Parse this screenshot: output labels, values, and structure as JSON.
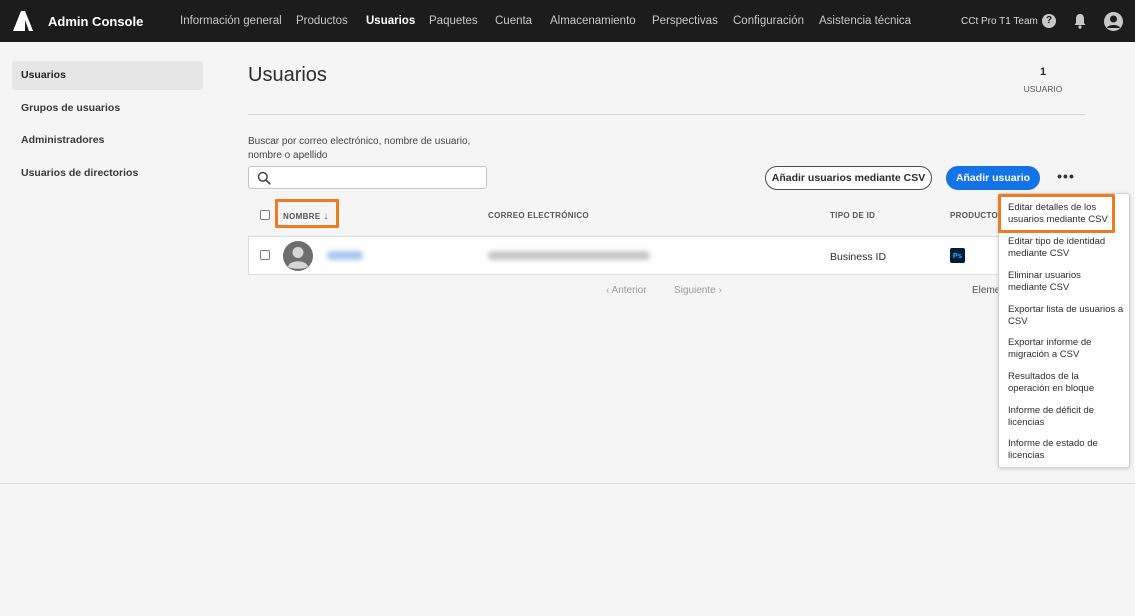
{
  "header": {
    "app_title": "Admin Console",
    "nav": [
      {
        "label": "Información general"
      },
      {
        "label": "Productos"
      },
      {
        "label": "Usuarios"
      },
      {
        "label": "Paquetes"
      },
      {
        "label": "Cuenta"
      },
      {
        "label": "Almacenamiento"
      },
      {
        "label": "Perspectivas"
      },
      {
        "label": "Configuración"
      },
      {
        "label": "Asistencia técnica"
      }
    ],
    "active_nav": "Usuarios",
    "team": "CCt Pro T1 Team",
    "help_glyph": "?",
    "icons": [
      "adobe-logo-icon",
      "help-icon",
      "bell-icon",
      "avatar-icon"
    ]
  },
  "sidebar": {
    "items": [
      {
        "label": "Usuarios",
        "active": true
      },
      {
        "label": "Grupos de usuarios"
      },
      {
        "label": "Administradores"
      },
      {
        "label": "Usuarios de directorios"
      }
    ]
  },
  "main": {
    "title": "Usuarios",
    "count": "1",
    "count_label": "USUARIO",
    "search_label": "Buscar por correo electrónico, nombre de usuario, nombre o apellido",
    "search_value": "",
    "btn_csv": "Añadir usuarios mediante CSV",
    "btn_add": "Añadir usuario",
    "more_glyph": "•••",
    "table": {
      "columns": [
        "NOMBRE",
        "CORREO ELECTRÓNICO",
        "TIPO DE ID",
        "PRODUCTOS"
      ],
      "sort_glyph": "↓",
      "rows": [
        {
          "type": "Business ID",
          "product": "Ps"
        }
      ]
    },
    "pager": {
      "prev": "‹  Anterior",
      "next": "Siguiente  ›"
    },
    "items_label": "Eleme"
  },
  "colors": {
    "accent": "#1473e6",
    "highlight": "#f07a22",
    "topbar": "#1c1c1c"
  },
  "menu": {
    "items": [
      {
        "label": "Editar detalles de los usuarios mediante CSV"
      },
      {
        "label": "Editar tipo de identidad mediante CSV"
      },
      {
        "label": "Eliminar usuarios mediante CSV"
      },
      {
        "label": "Exportar lista de usuarios a CSV"
      },
      {
        "label": "Exportar informe de migración a CSV"
      },
      {
        "label": "Resultados de la operación en bloque"
      },
      {
        "label": "Informe de déficit de licencias"
      },
      {
        "label": "Informe de estado de licencias"
      }
    ]
  }
}
